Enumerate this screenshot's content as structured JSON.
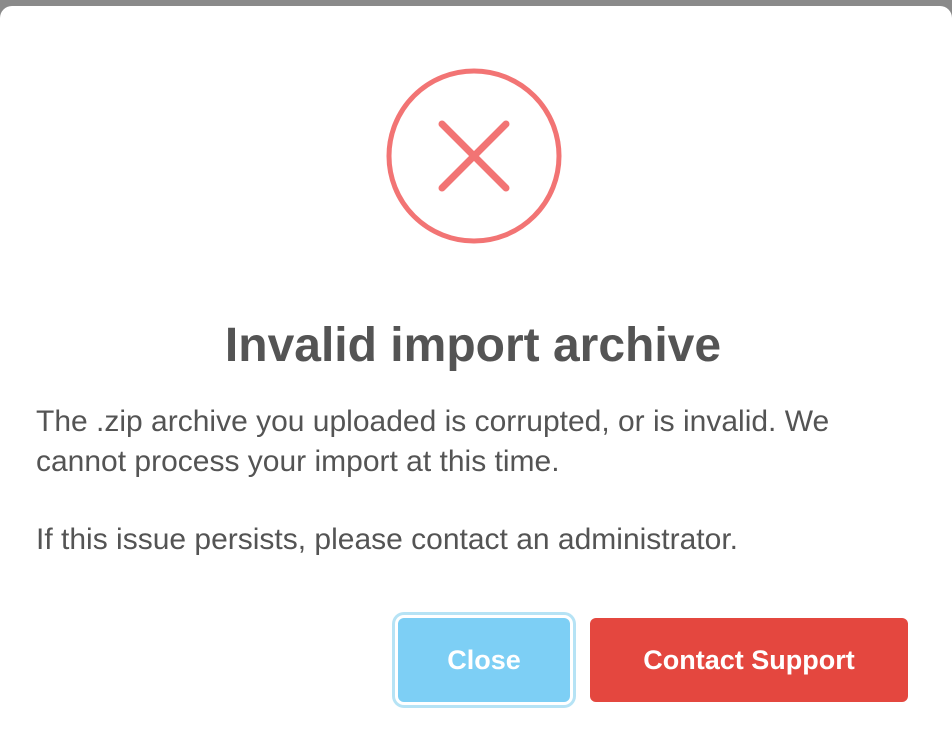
{
  "dialog": {
    "title": "Invalid import archive",
    "message_line1": "The .zip archive you uploaded is corrupted, or is invalid. We cannot process your import at this time.",
    "message_line2": "If this issue persists, please contact an administrator.",
    "icon": "error-x-circle-icon",
    "icon_color": "#f27474"
  },
  "buttons": {
    "close_label": "Close",
    "close_color": "#7dcff5",
    "contact_label": "Contact Support",
    "contact_color": "#e4473f"
  }
}
